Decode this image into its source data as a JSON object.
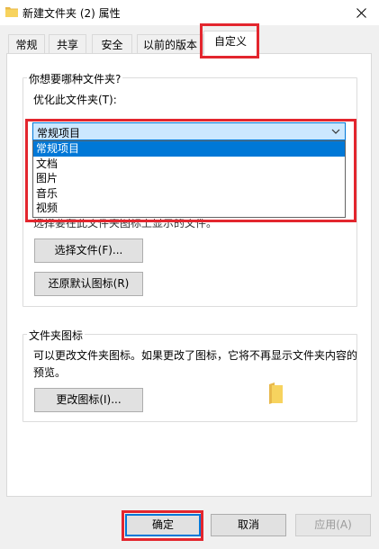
{
  "window": {
    "title": "新建文件夹 (2) 属性",
    "title_icon": "folder-icon",
    "close_icon": "close-icon"
  },
  "tabs": [
    {
      "label": "常规",
      "active": false
    },
    {
      "label": "共享",
      "active": false
    },
    {
      "label": "安全",
      "active": false
    },
    {
      "label": "以前的版本",
      "active": false
    },
    {
      "label": "自定义",
      "active": true
    }
  ],
  "optimize_group": {
    "title": "你想要哪种文件夹?",
    "optimize_label": "优化此文件夹(T):",
    "combo_value": "常规项目",
    "options": [
      "常规项目",
      "文档",
      "图片",
      "音乐",
      "视频"
    ],
    "selected_index": 0
  },
  "pictures_group": {
    "partial_text": "选择要在此文件夹图标上显示的文件。",
    "choose_file_button": "选择文件(F)...",
    "restore_default_button": "还原默认图标(R)"
  },
  "icon_group": {
    "title": "文件夹图标",
    "description": "可以更改文件夹图标。如果更改了图标，它将不再显示文件夹内容的预览。",
    "change_icon_button": "更改图标(I)..."
  },
  "footer": {
    "ok": "确定",
    "cancel": "取消",
    "apply": "应用(A)"
  },
  "colors": {
    "highlight": "#e3262e",
    "accent": "#0078d7",
    "folder": "#f5c542"
  }
}
